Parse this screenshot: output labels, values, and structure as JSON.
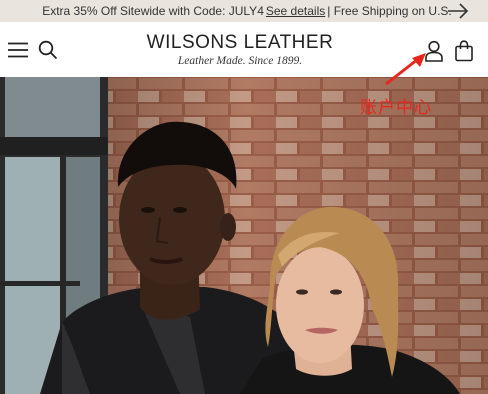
{
  "promo": {
    "text": "Extra 35% Off Sitewide with Code: JULY4",
    "link": "See details",
    "suffix": "| Free Shipping on U.S.",
    "arrow_icon": "arrow-right-icon"
  },
  "header": {
    "logo_title": "WILSONS LEATHER",
    "logo_tagline": "Leather Made. Since 1899.",
    "icons": [
      "hamburger-menu-icon",
      "search-icon",
      "user-account-icon",
      "shopping-bag-icon"
    ]
  },
  "annotation": {
    "label": "账户中心",
    "color": "#e8271c"
  },
  "hero": {
    "description_icon": "hero-photo"
  }
}
